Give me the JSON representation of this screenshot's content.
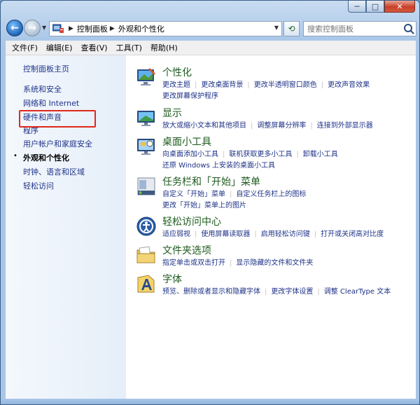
{
  "window": {
    "caption": {
      "minimize": "─",
      "maximize": "□",
      "close": "✕"
    }
  },
  "address": {
    "crumbs": [
      "控制面板",
      "外观和个性化"
    ],
    "search_placeholder": "搜索控制面板"
  },
  "menu": [
    "文件(F)",
    "编辑(E)",
    "查看(V)",
    "工具(T)",
    "帮助(H)"
  ],
  "sidebar": {
    "items": [
      {
        "label": "控制面板主页"
      },
      {
        "label": "系统和安全"
      },
      {
        "label": "网络和 Internet"
      },
      {
        "label": "硬件和声音"
      },
      {
        "label": "程序"
      },
      {
        "label": "用户帐户和家庭安全"
      },
      {
        "label": "外观和个性化",
        "current": true
      },
      {
        "label": "时钟、语言和区域"
      },
      {
        "label": "轻松访问"
      }
    ],
    "bullet": "•"
  },
  "categories": [
    {
      "title": "个性化",
      "icon": "personalization-icon",
      "links": [
        "更改主题",
        "更改桌面背景",
        "更改半透明窗口颜色",
        "更改声音效果",
        "更改屏幕保护程序"
      ]
    },
    {
      "title": "显示",
      "icon": "display-icon",
      "links": [
        "放大或缩小文本和其他项目",
        "调整屏幕分辨率",
        "连接到外部显示器"
      ]
    },
    {
      "title": "桌面小工具",
      "icon": "gadgets-icon",
      "links": [
        "向桌面添加小工具",
        "联机获取更多小工具",
        "卸载小工具",
        "还原 Windows 上安装的桌面小工具"
      ]
    },
    {
      "title": "任务栏和「开始」菜单",
      "icon": "taskbar-icon",
      "links": [
        "自定义「开始」菜单",
        "自定义任务栏上的图标",
        "更改「开始」菜单上的图片"
      ]
    },
    {
      "title": "轻松访问中心",
      "icon": "ease-of-access-icon",
      "links": [
        "适应弱视",
        "使用屏幕读取器",
        "启用轻松访问键",
        "打开或关闭高对比度"
      ]
    },
    {
      "title": "文件夹选项",
      "icon": "folder-options-icon",
      "links": [
        "指定单击或双击打开",
        "显示隐藏的文件和文件夹"
      ]
    },
    {
      "title": "字体",
      "icon": "fonts-icon",
      "links": [
        "预览、删除或者显示和隐藏字体",
        "更改字体设置",
        "调整 ClearType 文本"
      ]
    }
  ]
}
